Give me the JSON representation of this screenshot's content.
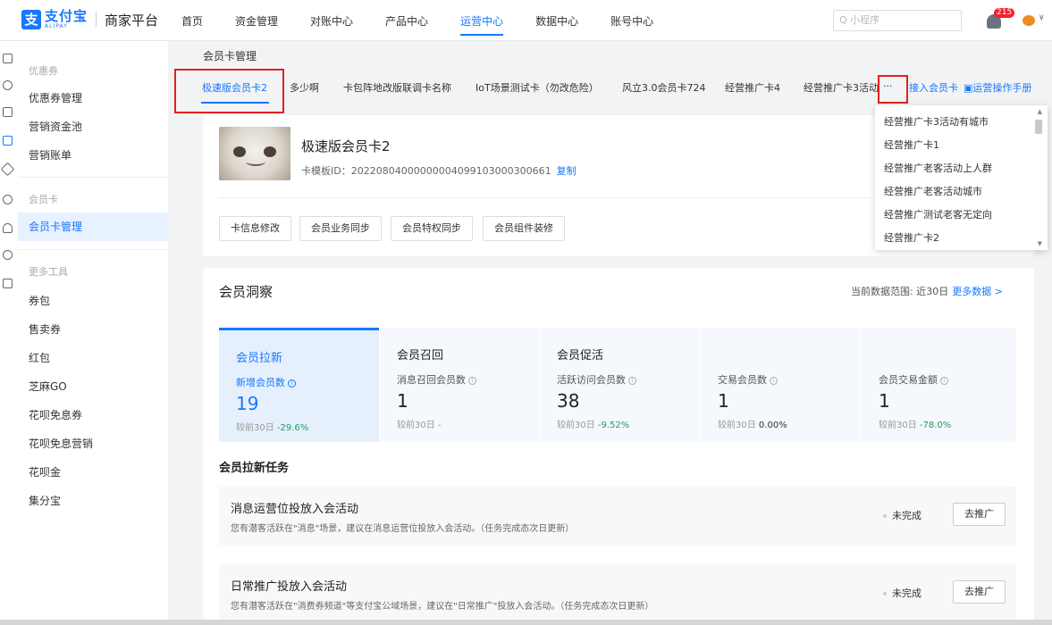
{
  "brand": {
    "logo_mark": "支",
    "logo_cn": "支付宝",
    "logo_en": "ALIPAY",
    "platform": "商家平台"
  },
  "nav": [
    "首页",
    "资金管理",
    "对账中心",
    "产品中心",
    "运营中心",
    "数据中心",
    "账号中心"
  ],
  "nav_active_index": 4,
  "search": {
    "placeholder": "Q 小程序"
  },
  "notifications": {
    "count": "215"
  },
  "sidebar": {
    "group_coupon": "优惠券",
    "coupon_items": [
      "优惠券管理",
      "营销资金池",
      "营销账单"
    ],
    "group_member": "会员卡",
    "member_items": [
      "会员卡管理"
    ],
    "group_tools": "更多工具",
    "tool_items": [
      "券包",
      "售卖券",
      "红包",
      "芝麻GO",
      "花呗免息券",
      "花呗免息营销",
      "花呗金",
      "集分宝"
    ]
  },
  "breadcrumb": "会员卡管理",
  "tabs": [
    "极速版会员卡2",
    "多少啊",
    "卡包阵地改版联调卡名称",
    "IoT场景测试卡（勿改危险）",
    "风立3.0会员卡724",
    "经营推广卡4",
    "经营推广卡3活动"
  ],
  "tab_more": "···",
  "tab_links": {
    "join": "接入会员卡",
    "manual": "运营操作手册"
  },
  "dropdown": [
    "经营推广卡3活动有城市",
    "经营推广卡1",
    "经营推广老客活动上人群",
    "经营推广老客活动城市",
    "经营推广测试老客无定向",
    "经营推广卡2"
  ],
  "card": {
    "title": "极速版会员卡2",
    "template_id": "卡模板ID：20220804000000004099103000300661",
    "copy": "复制",
    "actions": [
      "卡信息修改",
      "会员业务同步",
      "会员特权同步",
      "会员组件装修"
    ]
  },
  "insight": {
    "title": "会员洞察",
    "range": "当前数据范围: 近30日",
    "more": "更多数据 >",
    "columns": [
      {
        "head": "会员拉新",
        "label": "新增会员数",
        "value": "19",
        "cmp_prefix": "较前30日",
        "cmp_value": "-29.6%"
      },
      {
        "head": "会员召回",
        "label": "消息召回会员数",
        "value": "1",
        "cmp_prefix": "较前30日",
        "cmp_value": "-"
      },
      {
        "head": "会员促活",
        "label": "活跃访问会员数",
        "value": "38",
        "cmp_prefix": "较前30日",
        "cmp_value": "-9.52%"
      },
      {
        "head": "",
        "label": "交易会员数",
        "value": "1",
        "cmp_prefix": "较前30日",
        "cmp_value": "0.00%"
      },
      {
        "head": "",
        "label": "会员交易金额",
        "value": "1",
        "cmp_prefix": "较前30日",
        "cmp_value": "-78.0%"
      }
    ]
  },
  "tasks_title": "会员拉新任务",
  "tasks": [
    {
      "name": "消息运营位投放入会活动",
      "desc": "您有潜客活跃在\"消息\"场景，建议在消息运营位投放入会活动。（任务完成态次日更新）",
      "status": "未完成",
      "action": "去推广"
    },
    {
      "name": "日常推广投放入会活动",
      "desc": "您有潜客活跃在\"消费券频道\"等支付宝公域场景，建议在\"日常推广\"投放入会活动。（任务完成态次日更新）",
      "status": "未完成",
      "action": "去推广"
    }
  ],
  "colors": {
    "accent": "#1677ff",
    "positive": "#19a15f",
    "highlight_box": "#e02020"
  }
}
